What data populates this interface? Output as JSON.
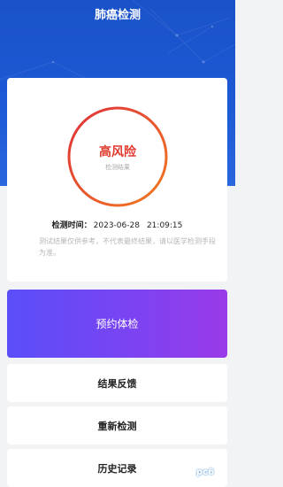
{
  "header": {
    "title": "肺癌检测"
  },
  "result": {
    "risk_label": "高风险",
    "risk_sub": "检测结果",
    "time_label": "检测时间：",
    "date": "2023-06-28",
    "time": "21:09:15",
    "disclaimer": "测试结果仅供参考，不代表最终结果，请以医学检测手段为准。"
  },
  "actions": {
    "book_exam": "预约体检",
    "feedback": "结果反馈",
    "retest": "重新检测",
    "history": "历史记录"
  },
  "colors": {
    "header_blue": "#1d5ad6",
    "risk_red": "#e03a2f",
    "ring_start": "#e0303a",
    "ring_end": "#f07a20",
    "button_gradient_start": "#5a4ef8",
    "button_gradient_end": "#9a3ae8"
  },
  "watermark": {
    "text": "pc6"
  }
}
